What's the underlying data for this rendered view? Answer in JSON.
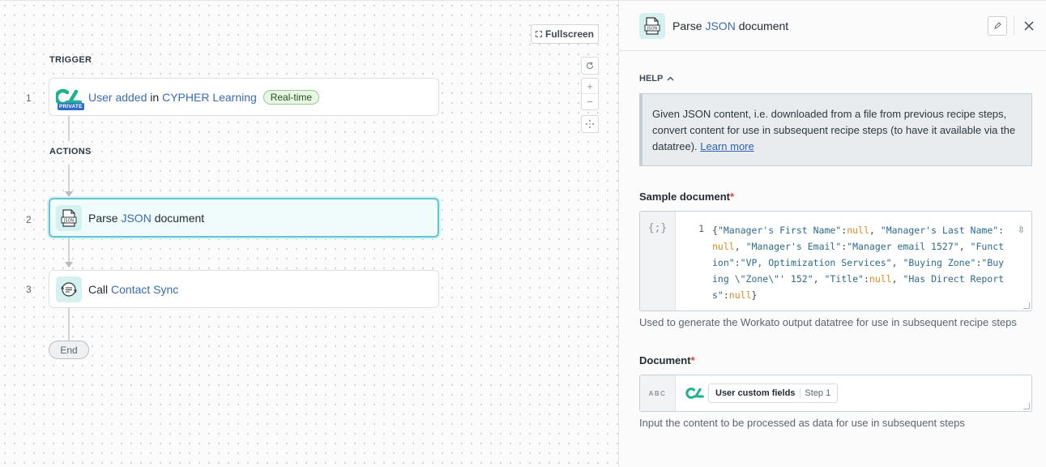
{
  "canvas": {
    "fullscreen_label": "Fullscreen",
    "trigger_label": "TRIGGER",
    "actions_label": "ACTIONS",
    "end_label": "End",
    "zoom_in": "+",
    "zoom_out": "−",
    "steps": [
      {
        "num": "1",
        "pre": "User added",
        "mid": " in ",
        "app": "CYPHER Learning",
        "badge": "Real-time",
        "private": "PRIVATE"
      },
      {
        "num": "2",
        "pre": "Parse ",
        "app": "JSON",
        "post": " document"
      },
      {
        "num": "3",
        "pre": "Call ",
        "app": "Contact Sync"
      }
    ]
  },
  "panel": {
    "title_pre": "Parse ",
    "title_app": "JSON",
    "title_post": " document",
    "help_label": "HELP",
    "help_text": "Given JSON content, i.e. downloaded from a file from previous recipe steps, convert content for use in subsequent recipe steps (to have it available via the datatree). ",
    "help_link": "Learn more",
    "sample_label": "Sample document",
    "required_mark": "*",
    "code_gutter_icon": "{;}",
    "code_line_number": "1",
    "code_segments": [
      {
        "t": "{",
        "c": "p"
      },
      {
        "t": "\"Manager's First Name\"",
        "c": "s"
      },
      {
        "t": ":",
        "c": "p"
      },
      {
        "t": "null",
        "c": "nl"
      },
      {
        "t": ", ",
        "c": "p"
      },
      {
        "t": "\"Manager's Last Name\"",
        "c": "s"
      },
      {
        "t": ":",
        "c": "p"
      },
      {
        "t": "null",
        "c": "nl"
      },
      {
        "t": ", ",
        "c": "p"
      },
      {
        "t": "\"Manager's Email\"",
        "c": "s"
      },
      {
        "t": ":",
        "c": "p"
      },
      {
        "t": "\"Manager email 1527\"",
        "c": "s"
      },
      {
        "t": ", ",
        "c": "p"
      },
      {
        "t": "\"Function\"",
        "c": "s"
      },
      {
        "t": ":",
        "c": "p"
      },
      {
        "t": "\"VP, Optimization Services\"",
        "c": "s"
      },
      {
        "t": ", ",
        "c": "p"
      },
      {
        "t": "\"Buying Zone\"",
        "c": "s"
      },
      {
        "t": ":",
        "c": "p"
      },
      {
        "t": "\"Buying \\\"Zone\\\"' 152\"",
        "c": "s"
      },
      {
        "t": ", ",
        "c": "p"
      },
      {
        "t": "\"Title\"",
        "c": "s"
      },
      {
        "t": ":",
        "c": "p"
      },
      {
        "t": "null",
        "c": "nl"
      },
      {
        "t": ", ",
        "c": "p"
      },
      {
        "t": "\"Has Direct Reports\"",
        "c": "s"
      },
      {
        "t": ":",
        "c": "p"
      },
      {
        "t": "null",
        "c": "nl"
      },
      {
        "t": "}",
        "c": "p"
      }
    ],
    "sample_hint": "Used to generate the Workato output datatree for use in subsequent recipe steps",
    "document_label": "Document",
    "document_gutter": "ABC",
    "pill_name": "User custom fields",
    "pill_step": "Step 1",
    "document_hint": "Input the content to be processed as data for use in subsequent steps"
  },
  "colors": {
    "accent_link": "#3a6bb5",
    "selected_border": "#5fc7cf",
    "cypher_green": "#1bb38f",
    "null_orange": "#e08a1e"
  }
}
